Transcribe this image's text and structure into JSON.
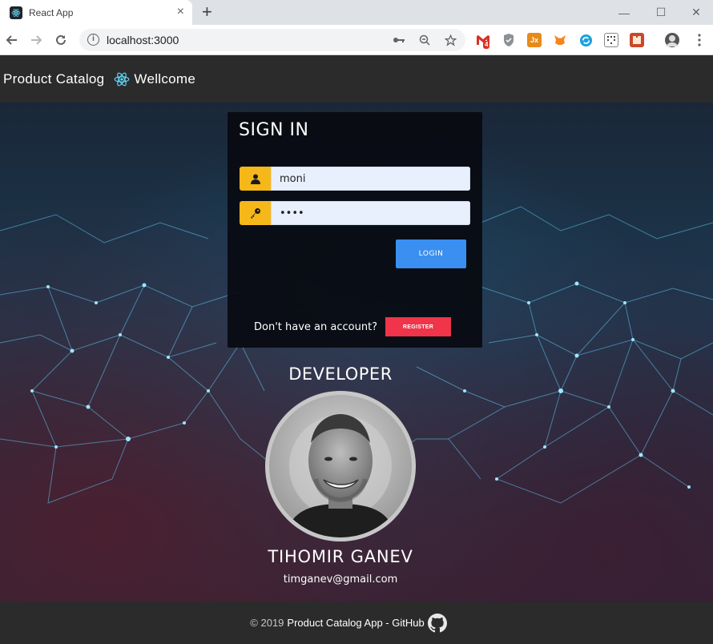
{
  "browser": {
    "tab_title": "React App",
    "tab_close": "×",
    "new_tab": "+",
    "url": "localhost:3000",
    "window_minimize": "—",
    "window_maximize": "☐",
    "window_close": "✕",
    "gmail_badge": "4",
    "ext_jx": "Jx"
  },
  "navbar": {
    "brand": "Product Catalog",
    "welcome": "Wellcome"
  },
  "signin": {
    "title": "SIGN IN",
    "username_value": "moni",
    "password_value": "••••",
    "login_label": "LOGIN",
    "no_account_text": "Don't have an account?",
    "register_label": "REGISTER"
  },
  "developer": {
    "title": "DEVELOPER",
    "name": "TIHOMIR GANEV",
    "email": "timganev@gmail.com"
  },
  "footer": {
    "copyright": "© 2019",
    "link_text": "Product Catalog App - GitHub"
  },
  "colors": {
    "input_icon_bg": "#f6b719",
    "login_bg": "#3a8ff0",
    "register_bg": "#f0344a",
    "navbar_bg": "#2b2b2b"
  },
  "icons": {
    "username": "user-icon",
    "password": "key-icon",
    "github": "github-icon",
    "react": "react-logo-icon"
  }
}
